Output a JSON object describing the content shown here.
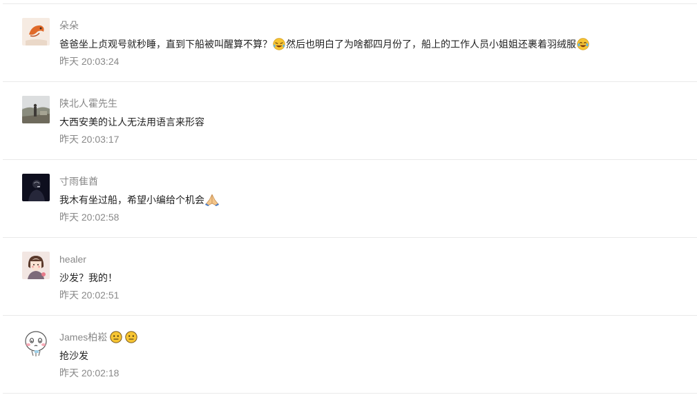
{
  "comments": [
    {
      "username": "朵朵",
      "text_before": "爸爸坐上贞观号就秒睡，直到下船被叫醒算不算？",
      "emoji_1": "laughing-crying-face",
      "text_middle": "然后也明白了为啥都四月份了，船上的工作人员小姐姐还裹着羽绒服",
      "emoji_2": "tears-of-joy-face",
      "time": "昨天 20:03:24",
      "avatar_icon": "orange-bird-avatar"
    },
    {
      "username": "陕北人霍先生",
      "text": "大西安美的让人无法用语言来形容",
      "time": "昨天 20:03:17",
      "avatar_icon": "landscape-photo-avatar"
    },
    {
      "username": "寸雨隹酋",
      "text": "我木有坐过船，希望小编给个机会",
      "emoji": "folded-hands",
      "time": "昨天 20:02:58",
      "avatar_icon": "dark-portrait-avatar"
    },
    {
      "username": "healer",
      "text": "沙发？我的！",
      "time": "昨天 20:02:51",
      "avatar_icon": "girl-illustration-avatar"
    },
    {
      "username": "James柏崧",
      "username_emoji": "neutral-face",
      "text": "抢沙发",
      "time": "昨天 20:02:18",
      "avatar_icon": "cartoon-face-avatar"
    }
  ],
  "colors": {
    "username": "#888888",
    "text": "#222222",
    "timestamp": "#888888",
    "divider": "#e9e9e9"
  }
}
